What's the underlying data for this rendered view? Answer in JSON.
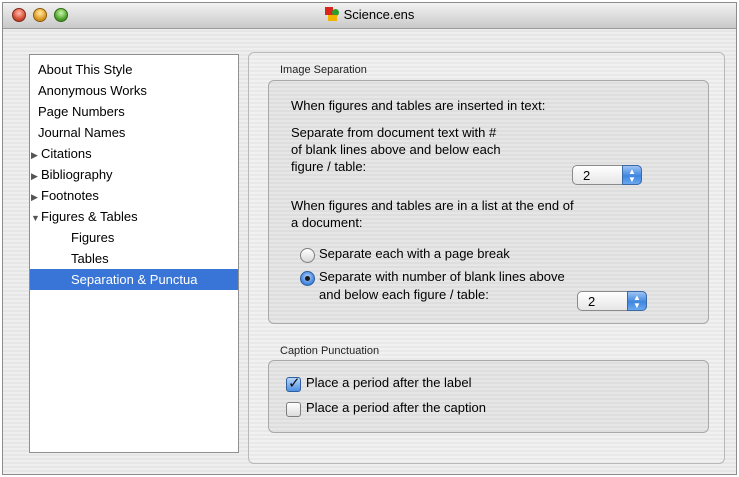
{
  "window": {
    "title": "Science.ens"
  },
  "sidebar": {
    "items": [
      {
        "label": "About This Style"
      },
      {
        "label": "Anonymous Works"
      },
      {
        "label": "Page Numbers"
      },
      {
        "label": "Journal Names"
      },
      {
        "label": "Citations",
        "expander": "▶"
      },
      {
        "label": "Bibliography",
        "expander": "▶"
      },
      {
        "label": "Footnotes",
        "expander": "▶"
      },
      {
        "label": "Figures & Tables",
        "expander": "▼"
      },
      {
        "label": "Figures"
      },
      {
        "label": "Tables"
      },
      {
        "label": "Separation & Punctua"
      }
    ],
    "selected_label": "Separation & Punctua",
    "selected_color": "#3875d7"
  },
  "image_separation": {
    "title": "Image Separation",
    "inserted_heading": "When figures and tables are inserted in text:",
    "inserted_line1": "Separate from document text with #",
    "inserted_line2": "of blank lines above and below each",
    "inserted_line3": "figure / table:",
    "inserted_value": "2",
    "list_heading_line1": "When figures and tables are in a list at the end of",
    "list_heading_line2": "a document:",
    "radio_page_break": "Separate each with a page break",
    "radio_blank_line1": "Separate with number of blank lines above",
    "radio_blank_line2": "and below each figure / table:",
    "list_value": "2"
  },
  "caption_punctuation": {
    "title": "Caption Punctuation",
    "period_after_label": "Place a period after the label",
    "period_after_label_checked": true,
    "period_after_caption": "Place a period after the caption",
    "period_after_caption_checked": false
  },
  "icons": {
    "popup_arrows": "▲▼"
  }
}
